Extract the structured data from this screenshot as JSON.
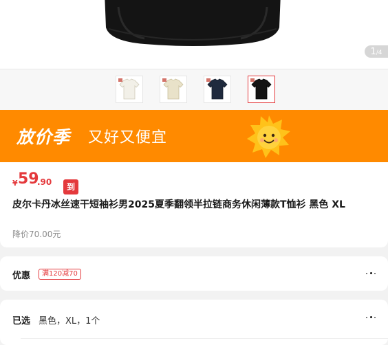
{
  "gallery": {
    "current_index": "1",
    "total_count": "/4",
    "thumbnails": [
      {
        "name": "white-shirt",
        "color": "#f2f0e8",
        "selected": false
      },
      {
        "name": "beige-shirt",
        "color": "#e9e2c9",
        "selected": false
      },
      {
        "name": "navy-shirt",
        "color": "#1f2a3d",
        "selected": false
      },
      {
        "name": "black-shirt",
        "color": "#141414",
        "selected": true
      }
    ]
  },
  "banner": {
    "title": "放价季",
    "subtitle": "又好又便宜",
    "background": "#ff8a00"
  },
  "price": {
    "currency": "¥",
    "integer": "59",
    "decimal": ".90",
    "badge": "到手价",
    "color": "#e4393c"
  },
  "product": {
    "title": "皮尔卡丹冰丝速干短袖衫男2025夏季翻领半拉链商务休闲薄款T恤衫 黑色 XL",
    "original_price": "降价70.00元"
  },
  "coupon": {
    "label": "优惠",
    "tag": "满120减70"
  },
  "selection": {
    "label": "已选",
    "value": "黑色，XL，1个"
  }
}
